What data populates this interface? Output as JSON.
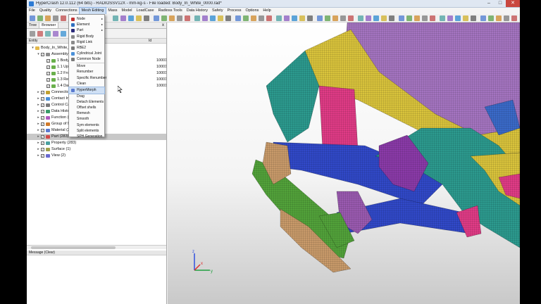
{
  "window": {
    "title": "HyperCrash 12.0.112 (64 bits) - RADIOSSV12X - mm-kg-s - File loaded: Body_In_White_0000.rad*",
    "min": "–",
    "max": "□",
    "close": "✕"
  },
  "menubar": [
    "File",
    "Quality",
    "Connections",
    "Mesh Editing",
    "Mass",
    "Model",
    "LoadCase",
    "Radioss Tools",
    "Data History",
    "Safety",
    "Process",
    "Options",
    "Help"
  ],
  "tabs": {
    "tree": "Tree",
    "browser": "Browser",
    "close": "x"
  },
  "columns": {
    "entity": "Entity",
    "id": "Id"
  },
  "tree": [
    {
      "label": "Body_In_White_0000",
      "value": "",
      "level": 0,
      "expander": "▾",
      "icon": "#e2b84a"
    },
    {
      "label": "Assembly   (6)",
      "value": "",
      "level": 1,
      "expander": "▾",
      "icon": "#8c8c8c"
    },
    {
      "label": "1 Body",
      "value": "100010",
      "level": 2,
      "expander": "",
      "icon": "#6ab04c"
    },
    {
      "label": "1.1 Upper-Bod",
      "value": "100010",
      "level": 2,
      "expander": "",
      "icon": "#6ab04c"
    },
    {
      "label": "1.2 Front_Flo",
      "value": "100010",
      "level": 2,
      "expander": "",
      "icon": "#6ab04c"
    },
    {
      "label": "1.3 Rear_Floo",
      "value": "100010",
      "level": 2,
      "expander": "",
      "icon": "#6ab04c"
    },
    {
      "label": "1.4 Dash-Boa",
      "value": "100010",
      "level": 2,
      "expander": "",
      "icon": "#6ab04c"
    },
    {
      "label": "Connection   (685)",
      "value": "",
      "level": 1,
      "expander": "▸",
      "icon": "#c0a030"
    },
    {
      "label": "Contact Interface",
      "value": "",
      "level": 1,
      "expander": "▸",
      "icon": "#4a90d9"
    },
    {
      "label": "Control Card   (6)",
      "value": "",
      "level": 1,
      "expander": "▸",
      "icon": "#7a7a7a"
    },
    {
      "label": "Data History   (1)",
      "value": "",
      "level": 1,
      "expander": "▸",
      "icon": "#3a9a6a"
    },
    {
      "label": "Function   (33)",
      "value": "",
      "level": 1,
      "expander": "▸",
      "icon": "#b05ac0"
    },
    {
      "label": "Group of Node   (1)",
      "value": "",
      "level": 1,
      "expander": "▸",
      "icon": "#d07a2a"
    },
    {
      "label": "Material   (283)",
      "value": "",
      "level": 1,
      "expander": "▸",
      "icon": "#5a7ad0"
    },
    {
      "label": "Part   (283)",
      "value": "",
      "level": 1,
      "expander": "▸",
      "icon": "#d04a4a",
      "selected": true
    },
    {
      "label": "Property   (283)",
      "value": "",
      "level": 1,
      "expander": "▸",
      "icon": "#4aa0a0"
    },
    {
      "label": "Surface   (1)",
      "value": "",
      "level": 1,
      "expander": "▸",
      "icon": "#a0a04a"
    },
    {
      "label": "View   (2)",
      "value": "",
      "level": 1,
      "expander": "▸",
      "icon": "#6a6ad0"
    }
  ],
  "message_panel": {
    "title": "Message (Clear)"
  },
  "mesh_menu": {
    "items": [
      "Node",
      "Element",
      "Part",
      "Rigid Body",
      "Rigid Link",
      "RBE2",
      "Cylindrical Joint",
      "Common Node",
      "Move",
      "Renumber",
      "Specific Renumber",
      "Clean",
      "HyperMorph",
      "Drag",
      "Detach Elements",
      "Offset shells",
      "Remesh",
      "Smooth",
      "Sym elements",
      "Split elements",
      "SPH Generation"
    ],
    "highlighted": "HyperMorph",
    "submenu_arrow": "▸"
  },
  "triad": {
    "x": "x",
    "y": "y",
    "z": "z"
  },
  "colors": {
    "roof": "#a474c0",
    "bumper": "#52a23a",
    "green_panel": "#2c9a8e",
    "pink_panel": "#df3b86",
    "blue_panel": "#3149c8",
    "yellow_panel": "#d9c33c",
    "tan_parts": "#c89a6a"
  }
}
